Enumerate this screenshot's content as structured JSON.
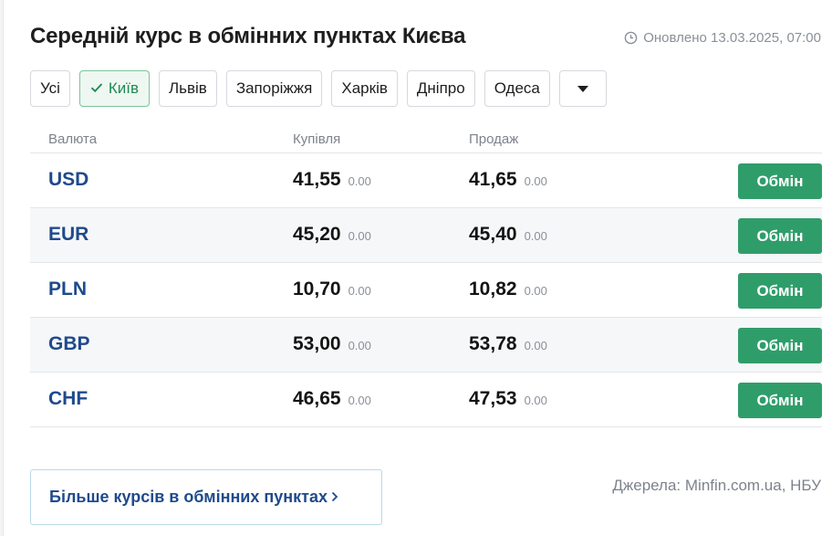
{
  "title": "Середній курс в обмінних пунктах Києва",
  "updated": {
    "icon": "clock-icon",
    "text": "Оновлено 13.03.2025, 07:00"
  },
  "cities": [
    {
      "label": "Усі",
      "active": false
    },
    {
      "label": "Київ",
      "active": true
    },
    {
      "label": "Львів",
      "active": false
    },
    {
      "label": "Запоріжжя",
      "active": false
    },
    {
      "label": "Харків",
      "active": false
    },
    {
      "label": "Дніпро",
      "active": false
    },
    {
      "label": "Одеса",
      "active": false
    }
  ],
  "table": {
    "headers": {
      "currency": "Валюта",
      "buy": "Купівля",
      "sell": "Продаж"
    },
    "rows": [
      {
        "currency": "USD",
        "buy": "41,55",
        "buy_change": "0.00",
        "sell": "41,65",
        "sell_change": "0.00",
        "action": "Обмін"
      },
      {
        "currency": "EUR",
        "buy": "45,20",
        "buy_change": "0.00",
        "sell": "45,40",
        "sell_change": "0.00",
        "action": "Обмін"
      },
      {
        "currency": "PLN",
        "buy": "10,70",
        "buy_change": "0.00",
        "sell": "10,82",
        "sell_change": "0.00",
        "action": "Обмін"
      },
      {
        "currency": "GBP",
        "buy": "53,00",
        "buy_change": "0.00",
        "sell": "53,78",
        "sell_change": "0.00",
        "action": "Обмін"
      },
      {
        "currency": "CHF",
        "buy": "46,65",
        "buy_change": "0.00",
        "sell": "47,53",
        "sell_change": "0.00",
        "action": "Обмін"
      }
    ]
  },
  "more_link": "Більше курсів в обмінних пунктах",
  "sources": "Джерела: Minfin.com.ua, НБУ",
  "colors": {
    "accent_green": "#2f9d6a",
    "currency_blue": "#1f4a8c",
    "active_chip_bg": "#eef7f1"
  }
}
